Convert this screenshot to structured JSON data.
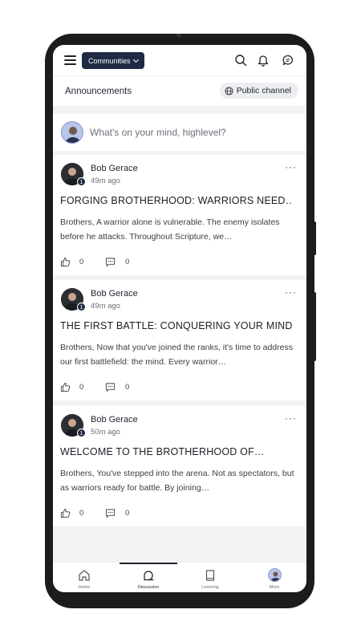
{
  "topbar": {
    "communities_label": "Communities"
  },
  "channel": {
    "title": "Announcements",
    "visibility_label": "Public channel"
  },
  "composer": {
    "placeholder": "What's on your mind, highlevel?"
  },
  "posts": [
    {
      "author": "Bob Gerace",
      "level": "1",
      "time": "49m ago",
      "title": "FORGING BROTHERHOOD: WARRIORS NEED…",
      "body": "Brothers, A warrior alone is vulnerable. The enemy isolates before he attacks. Throughout Scripture, we…",
      "likes": "0",
      "comments": "0"
    },
    {
      "author": "Bob Gerace",
      "level": "1",
      "time": "49m ago",
      "title": "THE FIRST BATTLE: CONQUERING YOUR MIND",
      "body": "Brothers, Now that you've joined the ranks, it's time to address our first battlefield: the mind. Every warrior…",
      "likes": "0",
      "comments": "0"
    },
    {
      "author": "Bob Gerace",
      "level": "1",
      "time": "50m ago",
      "title": "WELCOME TO THE BROTHERHOOD OF…",
      "body": "Brothers, You've stepped into the arena. Not as spectators, but as warriors ready for battle. By joining…",
      "likes": "0",
      "comments": "0"
    }
  ],
  "bottom_nav": {
    "items": [
      {
        "label": "Home",
        "icon": "home-icon"
      },
      {
        "label": "Discussion",
        "icon": "discussion-icon",
        "active": true
      },
      {
        "label": "Learning",
        "icon": "book-icon"
      },
      {
        "label": "More",
        "icon": "avatar"
      }
    ]
  }
}
